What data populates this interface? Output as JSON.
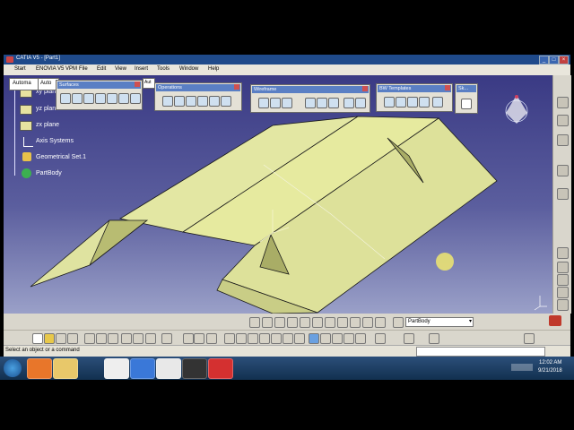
{
  "window": {
    "title": "CATIA V5 - [Part1]"
  },
  "menu": [
    "Start",
    "ENOVIA V5 VPM",
    "File",
    "Edit",
    "View",
    "Insert",
    "Tools",
    "Window",
    "Help"
  ],
  "tree": {
    "items": [
      "xy plane",
      "yz plane",
      "zx plane",
      "Axis Systems",
      "Geometrical Set.1",
      "PartBody"
    ]
  },
  "toolbars": {
    "surfaces": "Surfaces",
    "operations": "Operations",
    "wireframe": "Wireframe",
    "bw_templates": "BW Templates",
    "sketch": "Sk...",
    "mode_select": "Automa",
    "mode2": "Auto",
    "mode3": "Aut"
  },
  "bottom": {
    "part_select": "PartBody"
  },
  "status": {
    "prompt": "Select an object or a command"
  },
  "taskbar": {
    "time": "12:02 AM",
    "date": "9/21/2018"
  },
  "colors": {
    "viewport_top": "#3a3a84",
    "surface": "#e6ea9f",
    "surface_dark": "#c5c982",
    "edge": "#1a1a1a"
  }
}
